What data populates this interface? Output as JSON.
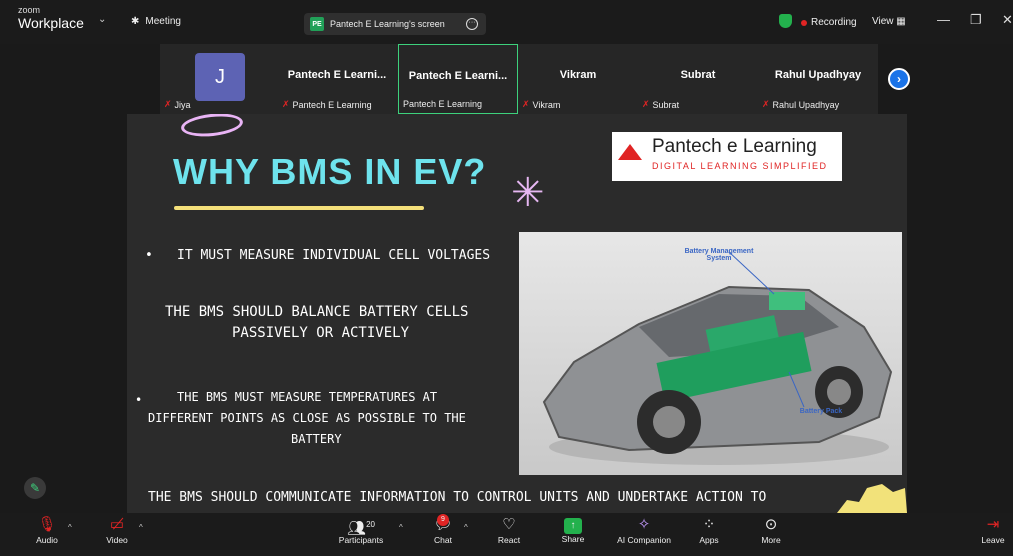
{
  "titlebar": {
    "brand_top": "zoom",
    "brand_bottom": "Workplace",
    "meeting_label": "Meeting",
    "share_pill_badge": "PE",
    "share_pill_label": "Pantech E Learning's screen",
    "recording_label": "Recording",
    "view_label": "View"
  },
  "participants": [
    {
      "tile_name": "",
      "label": "Jiya",
      "avatar_letter": "J"
    },
    {
      "tile_name": "Pantech E Learni...",
      "label": "Pantech E Learning"
    },
    {
      "tile_name": "Pantech E Learni...",
      "label": "Pantech E Learning"
    },
    {
      "tile_name": "Vikram",
      "label": "Vikram"
    },
    {
      "tile_name": "Subrat",
      "label": "Subrat"
    },
    {
      "tile_name": "Rahul Upadhyay",
      "label": "Rahul Upadhyay"
    }
  ],
  "slide": {
    "title": "WHY BMS IN EV?",
    "logo_main": "Pantech e Learning",
    "logo_sub": "DIGITAL LEARNING SIMPLIFIED",
    "bullet1": "IT MUST MEASURE INDIVIDUAL CELL VOLTAGES",
    "point2_line1": "THE BMS SHOULD BALANCE BATTERY CELLS",
    "point2_line2": "PASSIVELY OR ACTIVELY",
    "point3_line1": "THE BMS MUST MEASURE TEMPERATURES AT",
    "point3_line2": "DIFFERENT POINTS AS CLOSE AS POSSIBLE TO THE",
    "point3_line3": "BATTERY",
    "point4": "THE BMS SHOULD COMMUNICATE INFORMATION TO CONTROL UNITS AND UNDERTAKE ACTION TO",
    "car_label_bms": "Battery Management System",
    "car_label_pack": "Battery Pack"
  },
  "toolbar": {
    "audio": "Audio",
    "video": "Video",
    "participants": "Participants",
    "participants_count": "20",
    "chat": "Chat",
    "chat_badge": "9",
    "react": "React",
    "share": "Share",
    "ai": "AI Companion",
    "apps": "Apps",
    "more": "More",
    "leave": "Leave"
  }
}
